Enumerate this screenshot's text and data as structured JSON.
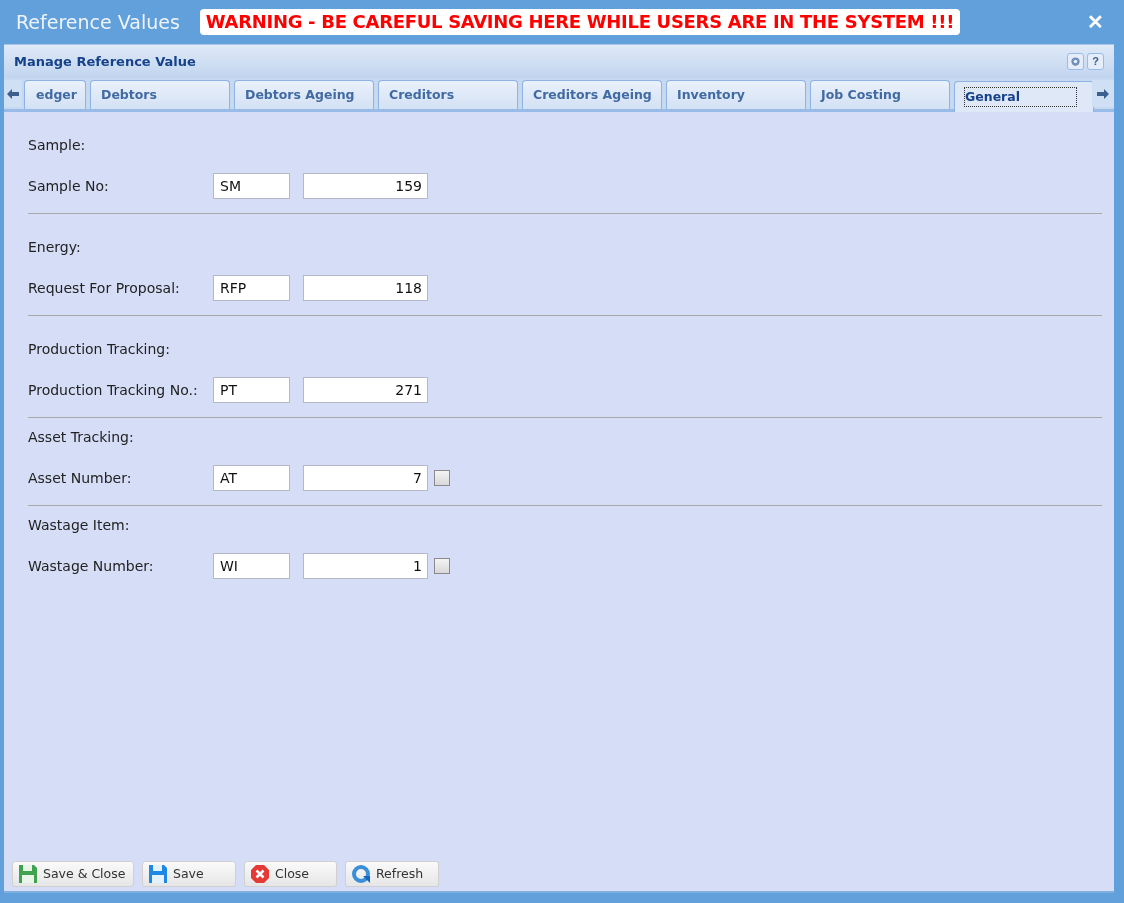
{
  "window": {
    "title": "Reference Values",
    "warning": "WARNING - BE CAREFUL SAVING HERE WHILE USERS ARE IN THE SYSTEM !!!",
    "close": "✕"
  },
  "panel": {
    "title": "Manage Reference Value",
    "help": "?"
  },
  "tabs": [
    {
      "label": "edger",
      "selected": false
    },
    {
      "label": "Debtors",
      "selected": false
    },
    {
      "label": "Debtors Ageing",
      "selected": false
    },
    {
      "label": "Creditors",
      "selected": false
    },
    {
      "label": "Creditors Ageing",
      "selected": false
    },
    {
      "label": "Inventory",
      "selected": false
    },
    {
      "label": "Job Costing",
      "selected": false
    },
    {
      "label": "General",
      "selected": true
    }
  ],
  "sections": [
    {
      "heading": "Sample:",
      "label": "Sample No:",
      "prefix": "SM",
      "number": "159"
    },
    {
      "heading": "Energy:",
      "label": "Request For Proposal:",
      "prefix": "RFP",
      "number": "118"
    },
    {
      "heading": "Production Tracking:",
      "label": "Production Tracking No.:",
      "prefix": "PT",
      "number": "271"
    },
    {
      "heading": "Asset Tracking:",
      "label": "Asset Number:",
      "prefix": "AT",
      "number": "7",
      "checkbox": {
        "checked": false
      }
    },
    {
      "heading": "Wastage Item:",
      "label": "Wastage Number:",
      "prefix": "WI",
      "number": "1",
      "checkbox": {
        "checked": false
      }
    }
  ],
  "buttons": [
    {
      "label": "Save & Close",
      "kind": "save-close"
    },
    {
      "label": "Save",
      "kind": "save"
    },
    {
      "label": "Close",
      "kind": "close"
    },
    {
      "label": "Refresh",
      "kind": "refresh"
    }
  ]
}
